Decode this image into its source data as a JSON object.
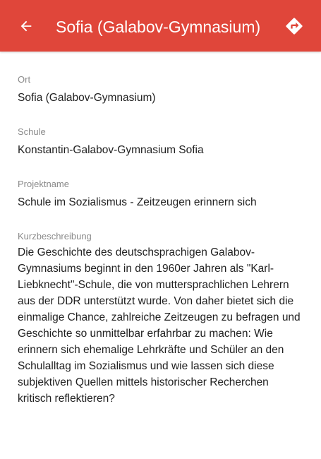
{
  "header": {
    "title": "Sofia (Galabov-Gymnasium)",
    "back_icon": "arrow-back-icon",
    "directions_icon": "directions-icon",
    "color": "#e0463a"
  },
  "details": {
    "ort_label": "Ort",
    "ort_value": "Sofia (Galabov-Gymnasium)",
    "schule_label": "Schule",
    "schule_value": "Konstantin-Galabov-Gymnasium Sofia",
    "projekt_label": "Projektname",
    "projekt_value": "Schule im Sozialismus - Zeitzeugen erinnern sich",
    "kurz_label": "Kurzbeschreibung",
    "kurz_value": "Die Geschichte des deutschsprachigen Galabov-Gymnasiums beginnt in den 1960er Jahren als \"Karl-Liebknecht\"-Schule, die von muttersprachlichen Lehrern aus der DDR unterstützt wurde. Von daher bietet sich die einmalige Chance, zahlreiche Zeitzeugen zu befragen und Geschichte so unmittelbar erfahrbar zu machen: Wie erinnern sich ehemalige Lehrkräfte und Schüler an den Schulalltag im Sozialismus und wie lassen sich diese subjektiven Quellen mittels historischer Recherchen kritisch reflektieren?"
  }
}
